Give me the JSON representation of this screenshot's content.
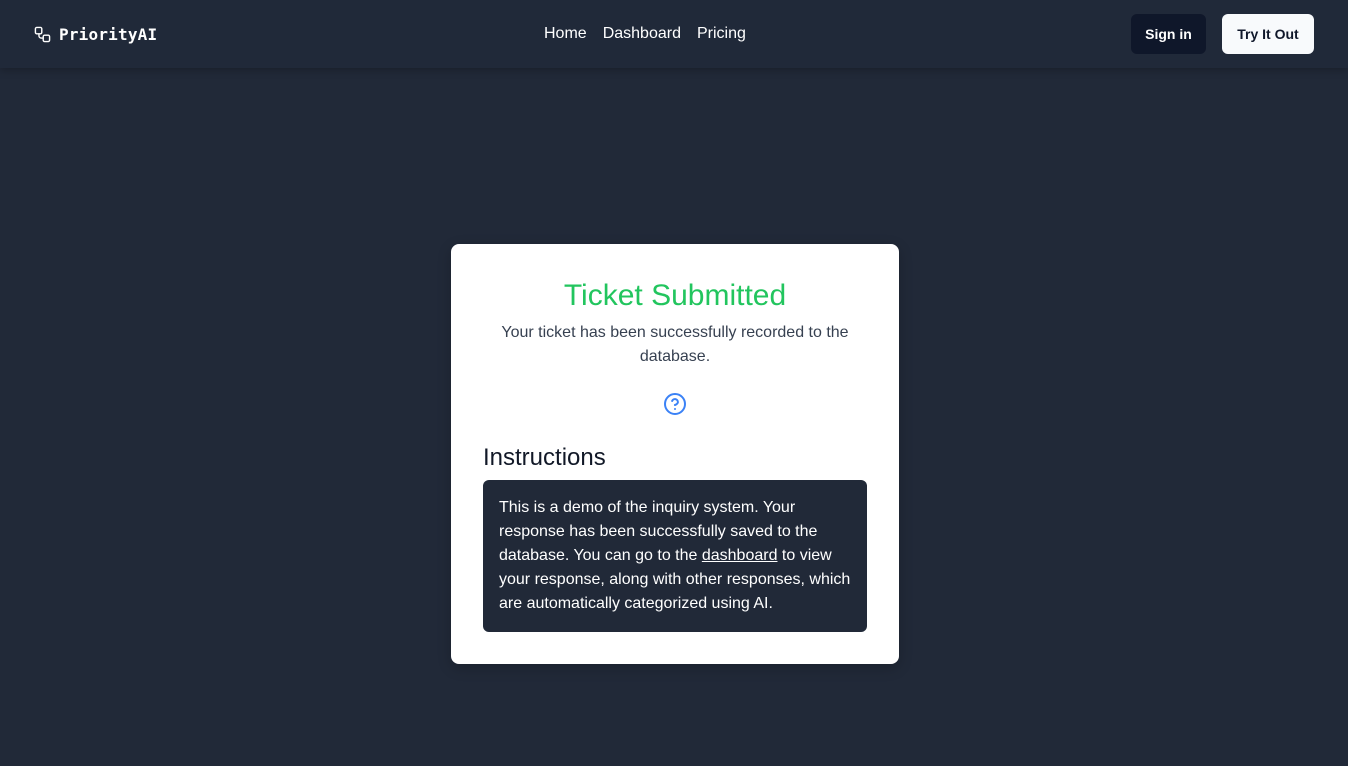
{
  "header": {
    "brand": "PriorityAI",
    "brand_icon": "link-icon",
    "nav": {
      "home": "Home",
      "dashboard": "Dashboard",
      "pricing": "Pricing"
    },
    "sign_in_label": "Sign in",
    "try_label": "Try It Out"
  },
  "card": {
    "title": "Ticket Submitted",
    "subtitle": "Your ticket has been successfully recorded to the database.",
    "help_icon": "question-circle-icon",
    "instructions_title": "Instructions",
    "instructions_before": "This is a demo of the inquiry system. Your response has been successfully saved to the database. You can go to the ",
    "instructions_link": "dashboard",
    "instructions_after": " to view your response, along with other responses, which are automatically categorized using AI."
  },
  "colors": {
    "background": "#212938",
    "accent_green": "#22c55e",
    "help_icon_blue": "#3b82f6",
    "signin_bg": "#0f172a"
  }
}
